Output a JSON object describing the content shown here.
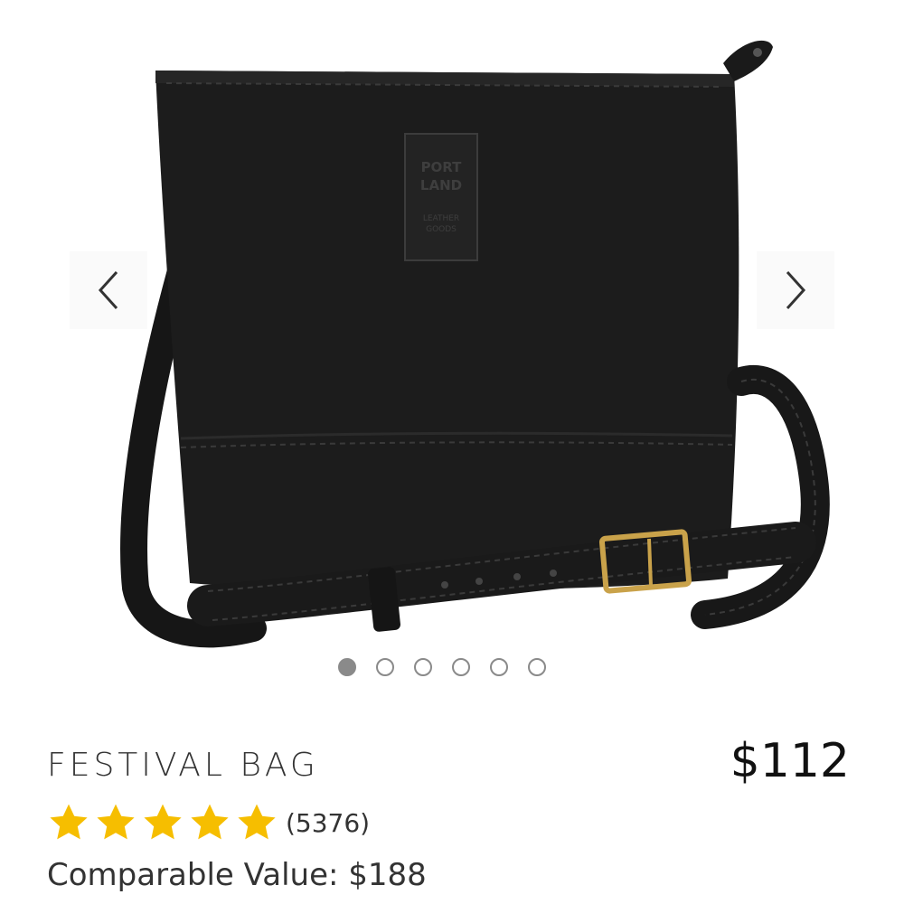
{
  "product": {
    "title": "FESTIVAL BAG",
    "price": "$112",
    "rating": 5,
    "review_count": "(5376)",
    "comparable_value": "Comparable Value: $188"
  },
  "gallery": {
    "image_count": 6,
    "active_index": 0,
    "brand_patch": [
      "PORT",
      "LAND",
      "LEATHER",
      "GOODS"
    ]
  },
  "icons": {
    "prev": "chevron-left-icon",
    "next": "chevron-right-icon",
    "star": "star-icon"
  },
  "colors": {
    "star": "#F6BE00",
    "bag": "#1c1c1c",
    "buckle": "#C9A24A",
    "dot": "#8a8a8a",
    "text": "#333333"
  }
}
